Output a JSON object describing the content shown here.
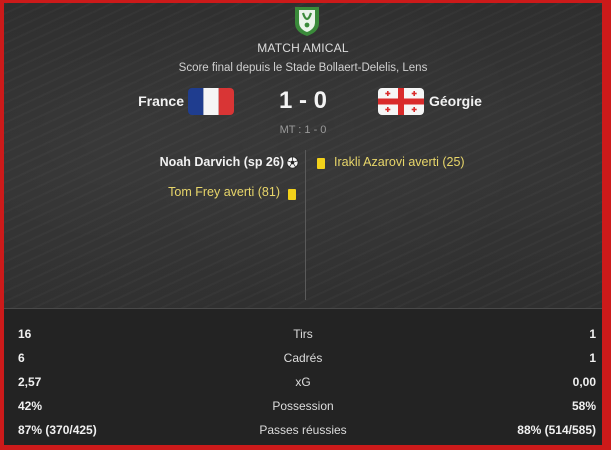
{
  "match": {
    "competition": "MATCH AMICAL",
    "venue_line": "Score final depuis le Stade Bollaert-Delelis, Lens",
    "home_team": "France",
    "away_team": "Géorgie",
    "score": "1 - 0",
    "half_time": "MT : 1 - 0"
  },
  "icons": {
    "competition": "competition-logo-icon",
    "home_flag": "france-flag-icon",
    "away_flag": "georgia-flag-icon",
    "goal": "soccer-ball-icon",
    "card": "yellow-card-icon"
  },
  "events": {
    "home_goal": "Noah Darvich (sp 26)",
    "away_card": "Irakli Azarovi averti (25)",
    "home_card": "Tom Frey averti (81)"
  },
  "stats": [
    {
      "home": "16",
      "label": "Tirs",
      "away": "1"
    },
    {
      "home": "6",
      "label": "Cadrés",
      "away": "1"
    },
    {
      "home": "2,57",
      "label": "xG",
      "away": "0,00"
    },
    {
      "home": "42%",
      "label": "Possession",
      "away": "58%"
    },
    {
      "home": "87% (370/425)",
      "label": "Passes réussies",
      "away": "88% (514/585)"
    }
  ],
  "colors": {
    "border": "#cc1a1a",
    "card_text": "#e8d66a",
    "card": "#f2d11a",
    "logo_green": "#3a8a3a"
  }
}
